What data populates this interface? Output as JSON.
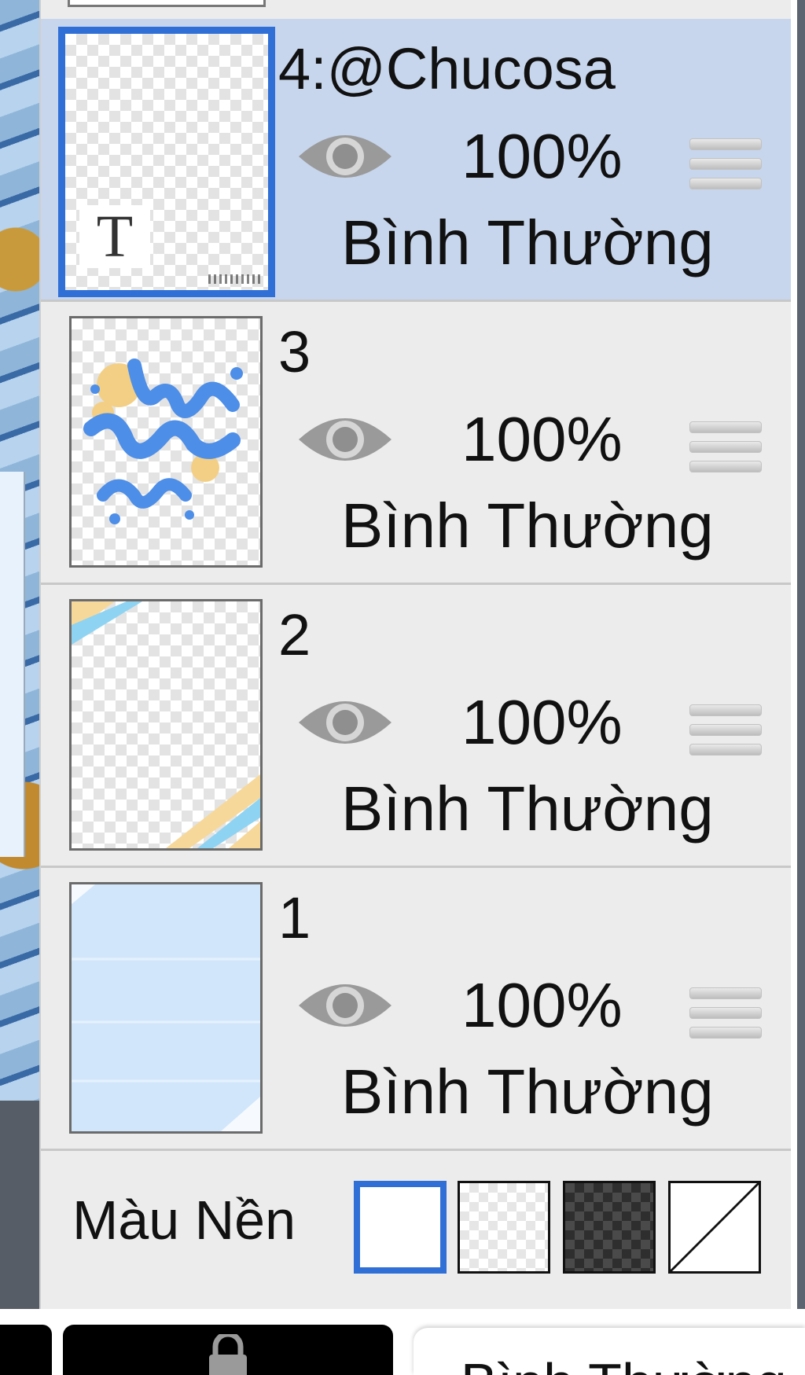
{
  "layers": [
    {
      "name": "4:@Chucosa",
      "visible": true,
      "opacity": "100%",
      "blend_mode": "Bình Thường",
      "selected": true,
      "type": "text"
    },
    {
      "name": "3",
      "visible": true,
      "opacity": "100%",
      "blend_mode": "Bình Thường",
      "selected": false,
      "type": "raster"
    },
    {
      "name": "2",
      "visible": true,
      "opacity": "100%",
      "blend_mode": "Bình Thường",
      "selected": false,
      "type": "raster"
    },
    {
      "name": "1",
      "visible": true,
      "opacity": "100%",
      "blend_mode": "Bình Thường",
      "selected": false,
      "type": "raster"
    }
  ],
  "text_layer_glyph": "T",
  "background": {
    "label": "Màu Nền",
    "options": [
      "white",
      "light-checker",
      "dark-checker",
      "none"
    ],
    "selected": "white"
  },
  "bottom_bar": {
    "blend_label": "Bình Thường"
  },
  "colors": {
    "selection_blue": "#2f6fd6",
    "selected_row": "#c7d6ec",
    "panel_bg": "#ececec"
  }
}
